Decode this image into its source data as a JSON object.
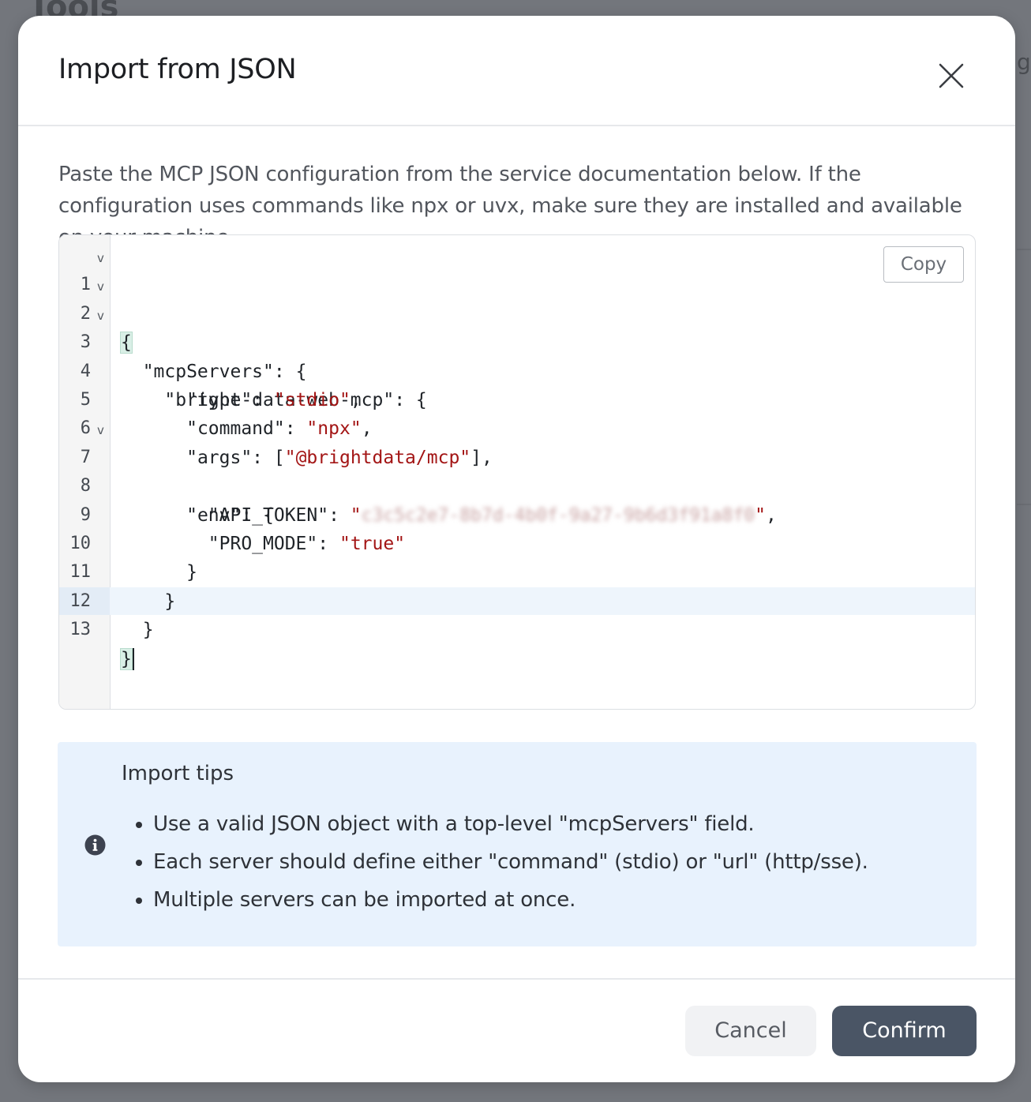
{
  "background": {
    "page_title": "Tools",
    "edge_text": "g"
  },
  "dialog": {
    "title": "Import from JSON",
    "close_icon": "close-icon",
    "description": "Paste the MCP JSON configuration from the service documentation below. If the configuration uses commands like npx or uvx, make sure they are installed and available on your machine.",
    "editor": {
      "copy_label": "Copy",
      "line_numbers": [
        "1",
        "2",
        "3",
        "4",
        "5",
        "6",
        "7",
        "8",
        "9",
        "10",
        "11",
        "12",
        "13"
      ],
      "folded_lines": [
        "1",
        "2",
        "3",
        "7"
      ],
      "active_line": "13",
      "config": {
        "root_key": "mcpServers",
        "server_name": "bright-data-web-mcp",
        "type_key": "type",
        "type_value": "stdio",
        "command_key": "command",
        "command_value": "npx",
        "args_key": "args",
        "args_value": "@brightdata/mcp",
        "env_key": "env",
        "api_token_key": "API_TOKEN",
        "api_token_value": "c3c5c2e7-8b7d-4b0f-9a27-9b6d3f91a8f0",
        "pro_mode_key": "PRO_MODE",
        "pro_mode_value": "true"
      }
    },
    "tips": {
      "icon": "info-icon",
      "title": "Import tips",
      "items": [
        "Use a valid JSON object with a top-level \"mcpServers\" field.",
        "Each server should define either \"command\" (stdio) or \"url\" (http/sse).",
        "Multiple servers can be imported at once."
      ]
    },
    "buttons": {
      "cancel": "Cancel",
      "confirm": "Confirm"
    }
  },
  "colors": {
    "overlay": "#73767c",
    "string": "#a31515",
    "tips_bg": "#e8f2fd",
    "confirm_bg": "#4a5565",
    "cancel_bg": "#f1f2f4"
  }
}
